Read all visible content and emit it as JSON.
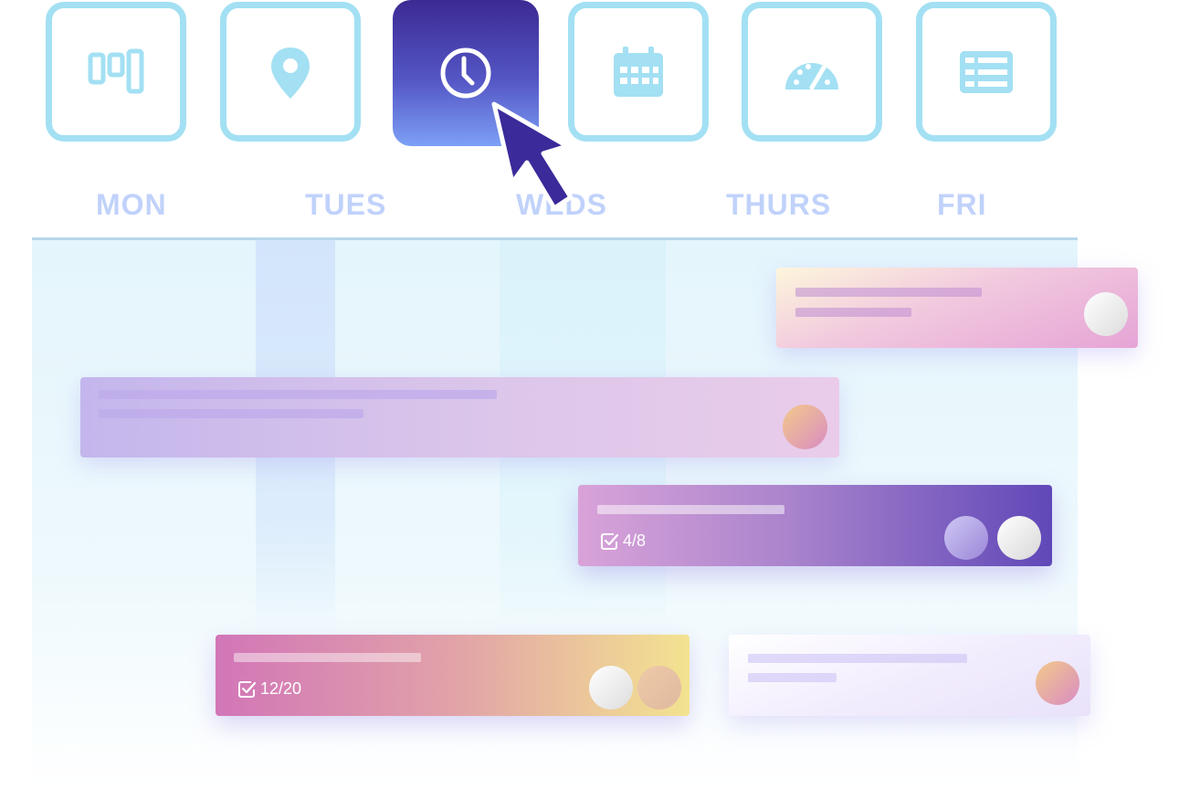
{
  "toolbar": {
    "views": [
      {
        "icon": "board-view-icon",
        "active": false
      },
      {
        "icon": "map-pin-icon",
        "active": false
      },
      {
        "icon": "clock-icon",
        "active": true
      },
      {
        "icon": "calendar-icon",
        "active": false
      },
      {
        "icon": "speedometer-icon",
        "active": false
      },
      {
        "icon": "table-view-icon",
        "active": false
      }
    ]
  },
  "days": [
    "MON",
    "TUES",
    "WEDS",
    "THURS",
    "FRI"
  ],
  "cards": [
    {
      "name": "card-pink-top",
      "avatars": 1
    },
    {
      "name": "card-lavender-wide",
      "avatars": 1
    },
    {
      "name": "card-purple",
      "checklist": "4/8",
      "avatars": 2
    },
    {
      "name": "card-pink-yellow",
      "checklist": "12/20",
      "avatars": 2
    },
    {
      "name": "card-pale-lavender",
      "avatars": 1
    }
  ],
  "colors": {
    "tile_border": "#a3e0f3",
    "active_tile_top": "#3c2a93",
    "active_tile_bottom": "#7da0f5",
    "day_label": "#c0d2fb",
    "cursor": "#3a2a9a"
  }
}
